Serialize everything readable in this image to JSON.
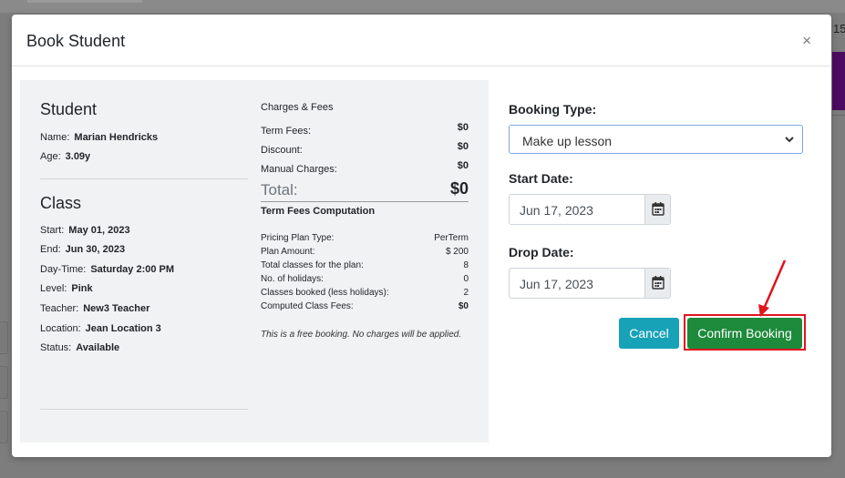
{
  "background": {
    "partial_number": "15"
  },
  "modal": {
    "title": "Book Student",
    "close_glyph": "×"
  },
  "student": {
    "heading": "Student",
    "name_label": "Name:",
    "name_value": "Marian Hendricks",
    "age_label": "Age:",
    "age_value": "3.09y"
  },
  "class": {
    "heading": "Class",
    "rows": [
      {
        "label": "Start:",
        "value": "May 01, 2023"
      },
      {
        "label": "End:",
        "value": "Jun 30, 2023"
      },
      {
        "label": "Day-Time:",
        "value": "Saturday 2:00 PM"
      },
      {
        "label": "Level:",
        "value": "Pink"
      },
      {
        "label": "Teacher:",
        "value": "New3 Teacher"
      },
      {
        "label": "Location:",
        "value": "Jean Location 3"
      },
      {
        "label": "Status:",
        "value": "Available"
      }
    ]
  },
  "charges": {
    "heading": "Charges & Fees",
    "term_fees_label": "Term Fees:",
    "term_fees_value": "$0",
    "discount_label": "Discount:",
    "discount_value": "$0",
    "manual_label": "Manual Charges:",
    "manual_value": "$0",
    "total_label": "Total:",
    "total_value": "$0"
  },
  "computation": {
    "heading": "Term Fees Computation",
    "rows": [
      {
        "label": "Pricing Plan Type:",
        "value": "PerTerm"
      },
      {
        "label": "Plan Amount:",
        "value": "$ 200"
      },
      {
        "label": "Total classes for the plan:",
        "value": "8"
      },
      {
        "label": "No. of holidays:",
        "value": "0"
      },
      {
        "label": "Classes booked (less holidays):",
        "value": "2"
      },
      {
        "label": "Computed Class Fees:",
        "value": "$0"
      }
    ],
    "note": "This is a free booking. No charges will be applied."
  },
  "form": {
    "booking_type_label": "Booking Type:",
    "booking_type_value": "Make up lesson",
    "start_date_label": "Start Date:",
    "start_date_value": "Jun 17, 2023",
    "drop_date_label": "Drop Date:",
    "drop_date_value": "Jun 17, 2023"
  },
  "buttons": {
    "cancel": "Cancel",
    "confirm": "Confirm Booking"
  },
  "colors": {
    "cancel": "#17a2b8",
    "confirm": "#1e8a3c",
    "highlight": "#e0141e"
  }
}
